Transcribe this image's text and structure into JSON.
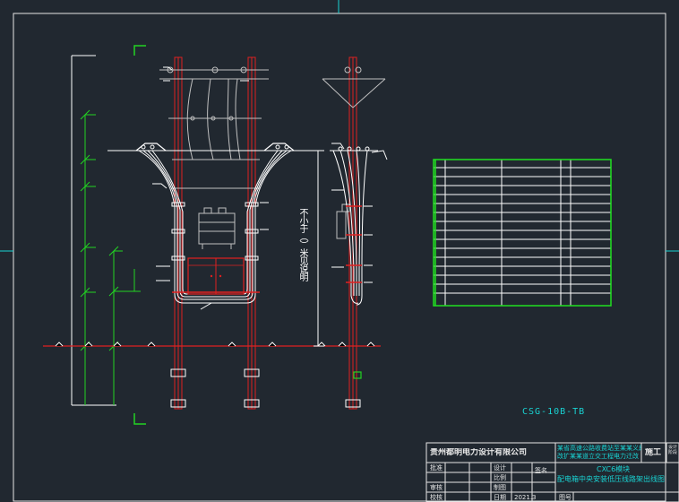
{
  "drawing": {
    "dimension_text": "不小于（）米见说明",
    "drawing_number": "CSG-10B-TB",
    "colors": {
      "background": "#212830",
      "frame": "#e6e6e6",
      "pole": "#e02020",
      "conductor": "#ffffff",
      "equipment": "#bfbfbf",
      "dimension_green": "#22d322",
      "text_cyan": "#19d3d3",
      "table_green": "#21e021"
    }
  },
  "title_block": {
    "company": "贵州都明电力设计有限公司",
    "project_line1": "某省高速公路收费站至某某义段",
    "project_line2": "改扩某某道立交工程电力迁改",
    "stage_label": "施工",
    "stage_small": "设计阶段",
    "drawing_title_line1": "CXC6模块",
    "drawing_title_line2": "配电箱中央安装低压线路架出线图",
    "role_approve": "批准",
    "role_review": "审核",
    "role_design": "设计",
    "role_check": "校核",
    "role_draw": "制图",
    "role_scale": "比例",
    "role_date": "日期",
    "role_drawing_no": "图号",
    "date": "2021.3",
    "signature": "签名"
  }
}
